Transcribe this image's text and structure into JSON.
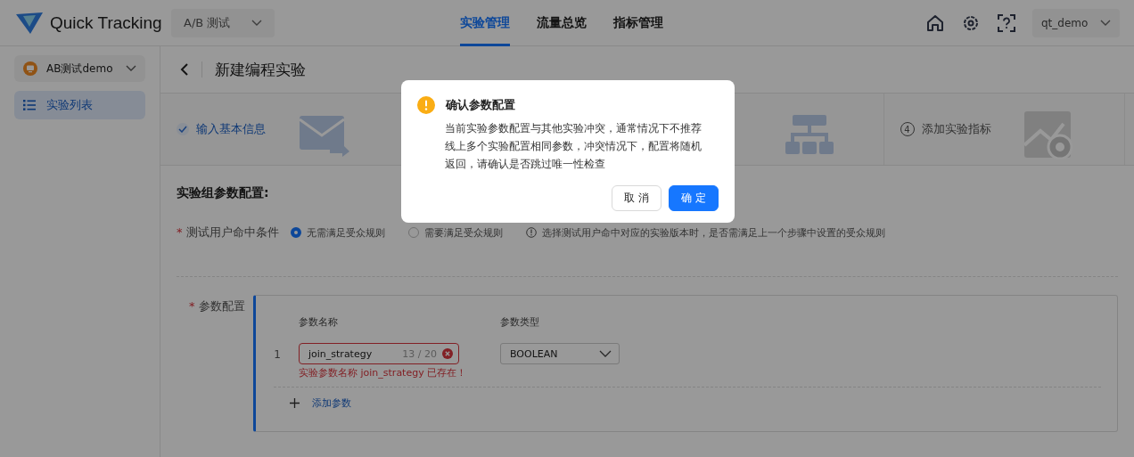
{
  "header": {
    "brand": "Quick Tracking",
    "product_select": "A/B 测试",
    "nav": [
      {
        "label": "实验管理",
        "selected": true
      },
      {
        "label": "流量总览",
        "selected": false
      },
      {
        "label": "指标管理",
        "selected": false
      }
    ],
    "user": "qt_demo"
  },
  "sidebar": {
    "app_select": "AB测试demo",
    "items": [
      {
        "label": "实验列表",
        "selected": true
      }
    ]
  },
  "page": {
    "title": "新建编程实验",
    "steps": [
      {
        "kind": "done",
        "label": "输入基本信息"
      },
      {
        "kind": "hidden"
      },
      {
        "kind": "hidden"
      },
      {
        "kind": "wait",
        "number": "4",
        "label": "添加实验指标"
      }
    ],
    "section_title": "实验组参数配置:",
    "hit_condition": {
      "required_mark": "*",
      "label": "测试用户命中条件",
      "options": [
        {
          "label": "无需满足受众规则",
          "selected": true
        },
        {
          "label": "需要满足受众规则",
          "selected": false
        }
      ],
      "hint": "选择测试用户命中对应的实验版本时，是否需满足上一个步骤中设置的受众规则"
    },
    "params": {
      "required_mark": "*",
      "label": "参数配置",
      "columns": [
        "参数名称",
        "参数类型"
      ],
      "rows": [
        {
          "index": "1",
          "name": "join_strategy",
          "counter": "13 / 20",
          "error": "实验参数名称 join_strategy 已存在！",
          "type": "BOOLEAN"
        }
      ],
      "add": "添加参数"
    }
  },
  "dialog": {
    "title": "确认参数配置",
    "message": "当前实验参数配置与其他实验冲突，通常情况下不推荐线上多个实验配置相同参数，冲突情况下，配置将随机返回，请确认是否跳过唯一性检查",
    "buttons": [
      {
        "label": "取 消",
        "kind": "default"
      },
      {
        "label": "确 定",
        "kind": "primary"
      }
    ]
  }
}
